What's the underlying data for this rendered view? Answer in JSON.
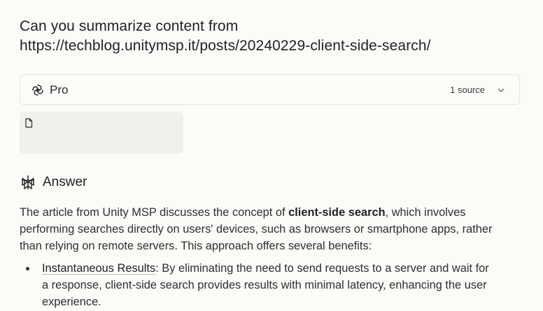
{
  "query": {
    "line1": "Can you summarize content from",
    "line2": "https://techblog.unitymsp.it/posts/20240229-client-side-search/"
  },
  "pro_bar": {
    "label": "Pro",
    "sources": "1 source",
    "icon": "pro-swirl-icon"
  },
  "source_card": {
    "icon": "document-icon"
  },
  "answer": {
    "title": "Answer",
    "icon": "perplexity-logo-icon",
    "intro_before": "The article from Unity MSP discusses the concept of ",
    "intro_bold": "client-side search",
    "intro_after": ", which involves performing searches directly on users' devices, such as browsers or smartphone apps, rather than relying on remote servers. This approach offers several benefits:",
    "bullets": [
      {
        "lead": "Instantaneous Results",
        "text": ": By eliminating the need to send requests to a server and wait for a response, client-side search provides results with minimal latency, enhancing the user experience."
      }
    ]
  },
  "colors": {
    "background": "#fbfbf8",
    "text": "#2a2c2e",
    "card": "#f0f0ec",
    "border": "#e6e6e1"
  }
}
